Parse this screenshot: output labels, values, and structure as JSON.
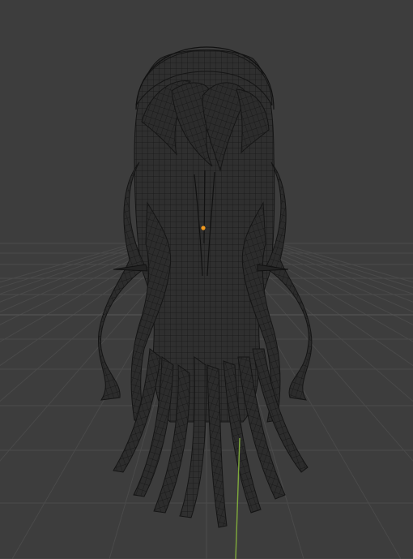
{
  "viewport": {
    "background_color": "#3d3d3d",
    "grid_line_color": "#4a4a4a",
    "grid_major_color": "#575757",
    "z_axis_color": "#7faa3c",
    "mesh_fill_color": "#2f2f2f",
    "wire_color": "#141414",
    "origin_color": "#f29a1e"
  },
  "object": {
    "name": "hair-mesh",
    "shading": "wireframe",
    "origin_icon": "object-origin-dot"
  }
}
